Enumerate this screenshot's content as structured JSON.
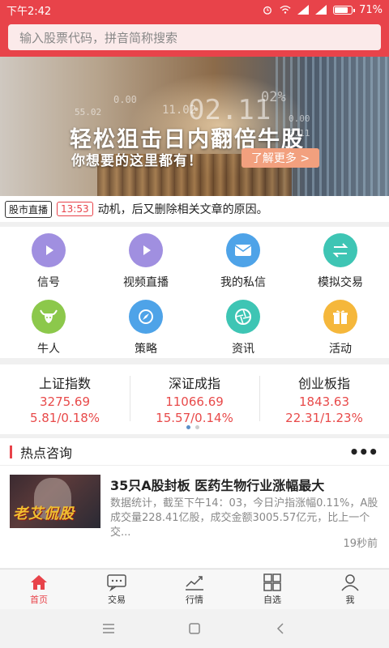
{
  "status_bar": {
    "time": "下午2:42",
    "battery": "71%",
    "battery_level": 0.71
  },
  "search": {
    "placeholder": "输入股票代码，拼音简称搜索"
  },
  "banner": {
    "title": "轻松狙击日内翻倍牛股",
    "subtitle": "你想要的这里都有！",
    "button": "了解更多 >",
    "bg_numbers": [
      "0.00",
      "55.02",
      "11.02",
      "02.11",
      "02%",
      "0.00",
      "0.11"
    ]
  },
  "ticker": {
    "tag": "股市直播",
    "time": "13:53",
    "text": "动机，后又删除相关文章的原因。"
  },
  "menu": [
    {
      "label": "信号",
      "icon": "signal-icon",
      "color": "#a08fe0"
    },
    {
      "label": "视频直播",
      "icon": "play-icon",
      "color": "#a08fe0"
    },
    {
      "label": "我的私信",
      "icon": "mail-icon",
      "color": "#4ea3e8"
    },
    {
      "label": "模拟交易",
      "icon": "exchange-icon",
      "color": "#3ec5b4"
    },
    {
      "label": "牛人",
      "icon": "bull-icon",
      "color": "#8cc84b"
    },
    {
      "label": "策略",
      "icon": "compass-icon",
      "color": "#4ea3e8"
    },
    {
      "label": "资讯",
      "icon": "aperture-icon",
      "color": "#3ec5b4"
    },
    {
      "label": "活动",
      "icon": "gift-icon",
      "color": "#f5b73b"
    }
  ],
  "indices": [
    {
      "name": "上证指数",
      "value": "3275.69",
      "change": "5.81/0.18%"
    },
    {
      "name": "深证成指",
      "value": "11066.69",
      "change": "15.57/0.14%"
    },
    {
      "name": "创业板指",
      "value": "1843.63",
      "change": "22.31/1.23%"
    }
  ],
  "news": {
    "section_title": "热点咨询",
    "more": "•••",
    "item": {
      "thumb_text": "老艾侃股",
      "title": "35只A股封板 医药生物行业涨幅最大",
      "desc": "数据统计，截至下午14：03，今日沪指涨幅0.11%，A股成交量228.41亿股，成交金额3005.57亿元，比上一个交...",
      "time": "19秒前"
    }
  },
  "tabs": [
    {
      "label": "首页",
      "icon": "home-icon"
    },
    {
      "label": "交易",
      "icon": "chat-icon"
    },
    {
      "label": "行情",
      "icon": "chart-icon"
    },
    {
      "label": "自选",
      "icon": "grid-icon"
    },
    {
      "label": "我",
      "icon": "user-icon"
    }
  ],
  "colors": {
    "brand": "#e8434a",
    "up": "#e84a4a"
  }
}
